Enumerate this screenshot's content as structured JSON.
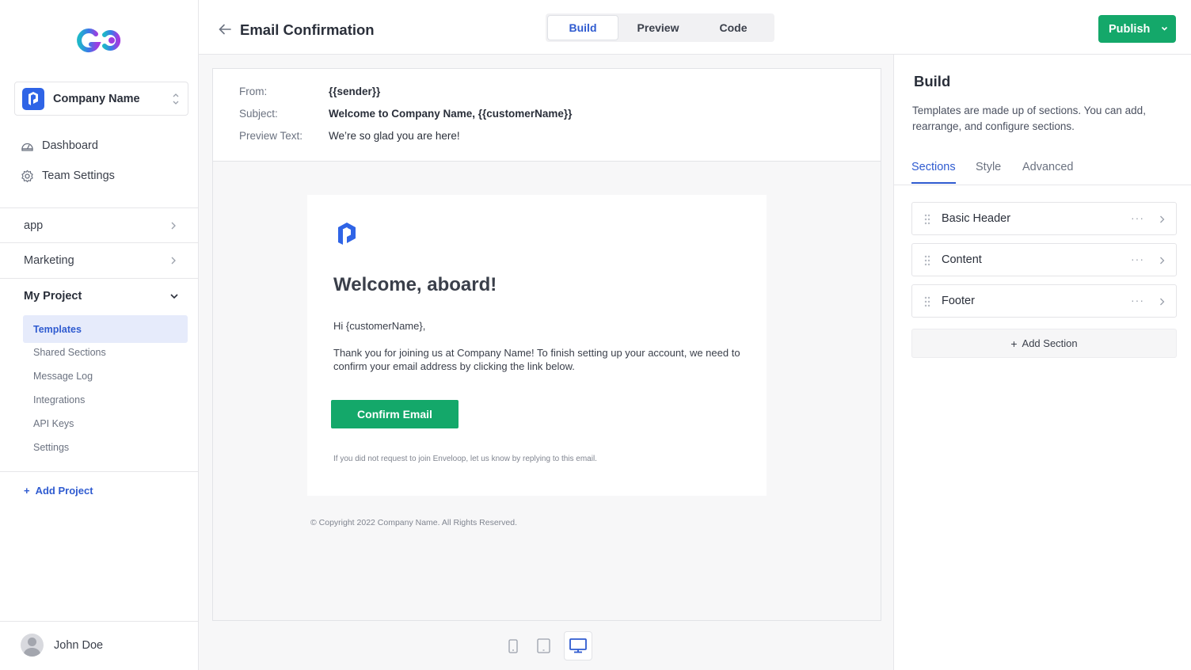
{
  "sidebar": {
    "company": "Company Name",
    "nav_top": [
      {
        "label": "Dashboard",
        "icon": "dashboard-icon"
      },
      {
        "label": "Team Settings",
        "icon": "gear-icon"
      }
    ],
    "groups": [
      {
        "label": "app"
      },
      {
        "label": "Marketing"
      },
      {
        "label": "My Project"
      }
    ],
    "project_items": [
      "Templates",
      "Shared Sections",
      "Message Log",
      "Integrations",
      "API Keys",
      "Settings"
    ],
    "add_project": "Add Project",
    "user": "John Doe"
  },
  "header": {
    "title": "Email Confirmation",
    "tabs": [
      "Build",
      "Preview",
      "Code"
    ],
    "active_tab": "Build",
    "publish": "Publish"
  },
  "meta": {
    "from_label": "From:",
    "from_value": "{{sender}}",
    "subject_label": "Subject:",
    "subject_value": "Welcome to Company Name, {{customerName}}",
    "preview_label": "Preview Text:",
    "preview_value": "We’re so glad you are here!"
  },
  "email": {
    "heading": "Welcome, aboard!",
    "greeting": "Hi {customerName},",
    "body": "Thank you for joining us at Company Name! To finish setting up your account, we need to confirm your email address by clicking the link below.",
    "button": "Confirm Email",
    "note": "If you did not request to join Enveloop, let us know by replying to this email.",
    "copyright": "© Copyright 2022 Company Name. All Rights Reserved."
  },
  "devices": [
    "mobile-icon",
    "tablet-icon",
    "desktop-icon"
  ],
  "panel": {
    "title": "Build",
    "description": "Templates are made up of sections. You can add, rearrange, and configure sections.",
    "tabs": [
      "Sections",
      "Style",
      "Advanced"
    ],
    "sections": [
      "Basic Header",
      "Content",
      "Footer"
    ],
    "add_section": "Add Section"
  },
  "colors": {
    "accent": "#2f5bd0",
    "brand_green": "#14a86a"
  }
}
